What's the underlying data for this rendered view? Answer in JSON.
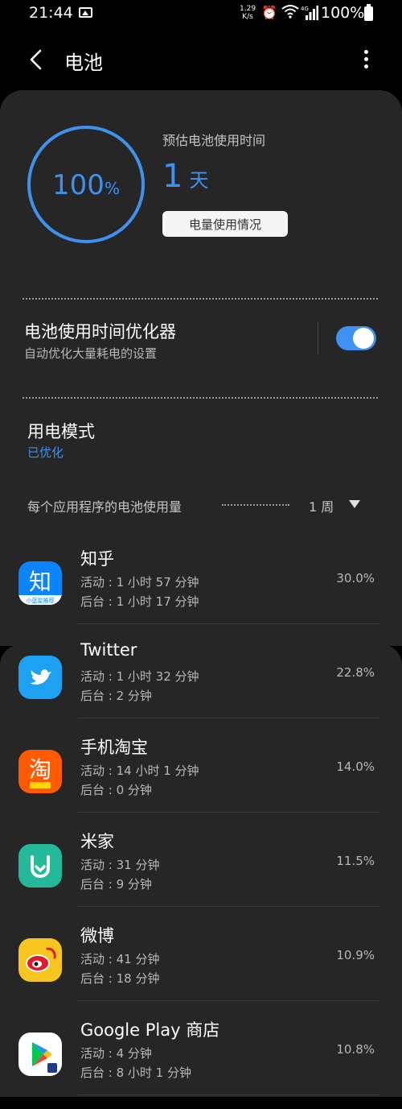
{
  "status_bar": {
    "time": "21:44",
    "net_speed_value": "1.29",
    "net_speed_unit": "K/s",
    "network_type": "4G",
    "battery_text": "100%",
    "icons": [
      "image-icon",
      "alarm-icon",
      "wifi-icon",
      "signal-icon",
      "battery-icon"
    ]
  },
  "appbar": {
    "title": "电池"
  },
  "battery": {
    "level_value": "100",
    "level_unit": "%",
    "estimate_label": "预估电池使用时间",
    "estimate_value": "1",
    "estimate_unit": "天",
    "usage_button": "电量使用情况"
  },
  "optimizer": {
    "title": "电池使用时间优化器",
    "subtitle": "自动优化大量耗电的设置",
    "enabled": true
  },
  "power_mode": {
    "title": "用电模式",
    "value": "已优化"
  },
  "per_app": {
    "label": "每个应用程序的电池使用量",
    "period": "1 周",
    "apps": [
      {
        "name": "知乎",
        "active": "活动 : 1 小时 57 分钟",
        "background": "后台 : 1 小时 17 分钟",
        "percent": "30.0%",
        "icon_badge": "小蓝星推荐"
      },
      {
        "name": "Twitter",
        "active": "活动 : 1 小时 32 分钟",
        "background": "后台 : 2 分钟",
        "percent": "22.8%"
      },
      {
        "name": "手机淘宝",
        "active": "活动 : 14 小时 1 分钟",
        "background": "后台 : 0 分钟",
        "percent": "14.0%"
      },
      {
        "name": "米家",
        "active": "活动 : 31 分钟",
        "background": "后台 : 9 分钟",
        "percent": "11.5%"
      },
      {
        "name": "微博",
        "active": "活动 : 41 分钟",
        "background": "后台 : 18 分钟",
        "percent": "10.9%"
      },
      {
        "name": "Google Play 商店",
        "active": "活动 : 4 分钟",
        "background": "后台 : 8 小时 1 分钟",
        "percent": "10.8%"
      }
    ]
  },
  "colors": {
    "accent": "#3e91f1",
    "card": "#262626",
    "background": "#000000"
  }
}
